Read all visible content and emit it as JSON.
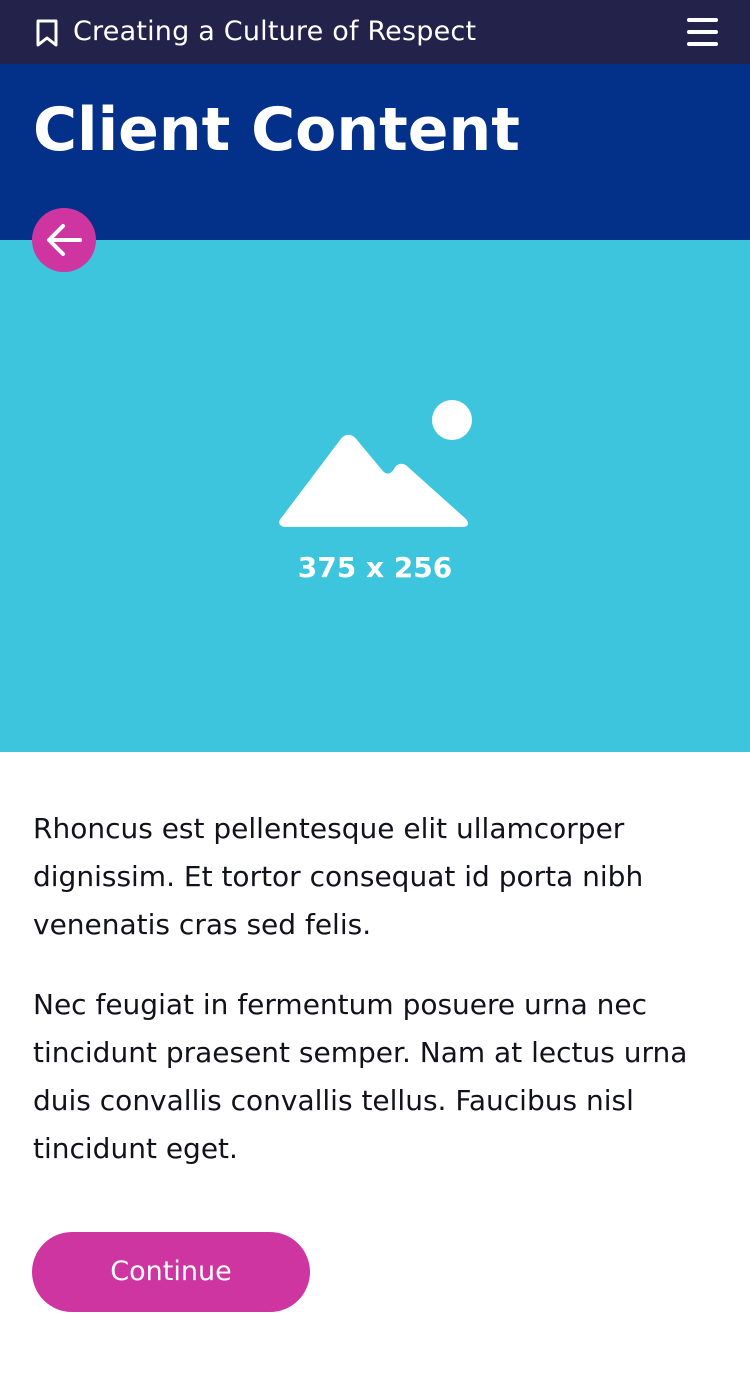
{
  "topbar": {
    "title": "Creating a Culture of Respect",
    "bookmark_icon": "bookmark-icon",
    "menu_icon": "hamburger-menu-icon"
  },
  "header": {
    "title": "Client Content"
  },
  "back_button": {
    "icon": "arrow-left-icon"
  },
  "hero": {
    "icon": "image-placeholder-icon",
    "dimensions_label": "375 x 256"
  },
  "content": {
    "paragraphs": [
      "Rhoncus est pellentesque elit ullamcorper dignissim. Et tortor consequat id porta nibh venenatis cras sed felis.",
      "Nec feugiat in fermentum posuere urna nec tincidunt praesent semper. Nam at lectus urna duis convallis convallis tellus. Faucibus nisl tincidunt eget."
    ]
  },
  "continue_button": {
    "label": "Continue"
  },
  "colors": {
    "topbar_bg": "#22224a",
    "header_bg": "#03318a",
    "hero_bg": "#3cc5dc",
    "accent": "#cf35a0",
    "text": "#12121c"
  }
}
